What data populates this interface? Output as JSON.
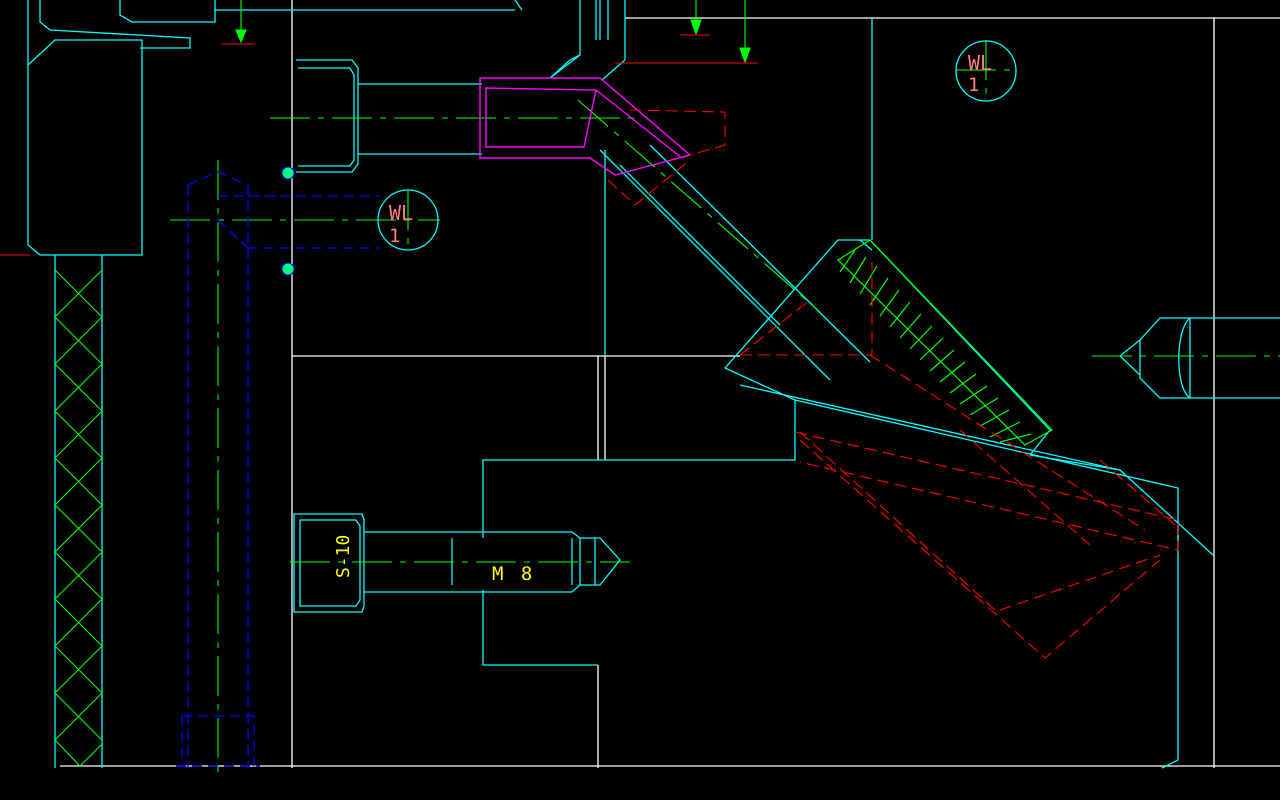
{
  "colors": {
    "cyan": "#00ffff",
    "white": "#ffffff",
    "green": "#00ff00",
    "red": "#ff0000",
    "blue": "#0000ff",
    "magenta": "#ff00ff",
    "yellow": "#ffff00",
    "pink": "#ff7f7f",
    "grip": "#00ff7f"
  },
  "labels": {
    "wl_tag_1": {
      "line1": "WL",
      "line2": "1"
    },
    "wl_tag_2": {
      "line1": "WL",
      "line2": "1"
    },
    "screw_head_size": "S-10",
    "thread_callout": "M 8"
  }
}
